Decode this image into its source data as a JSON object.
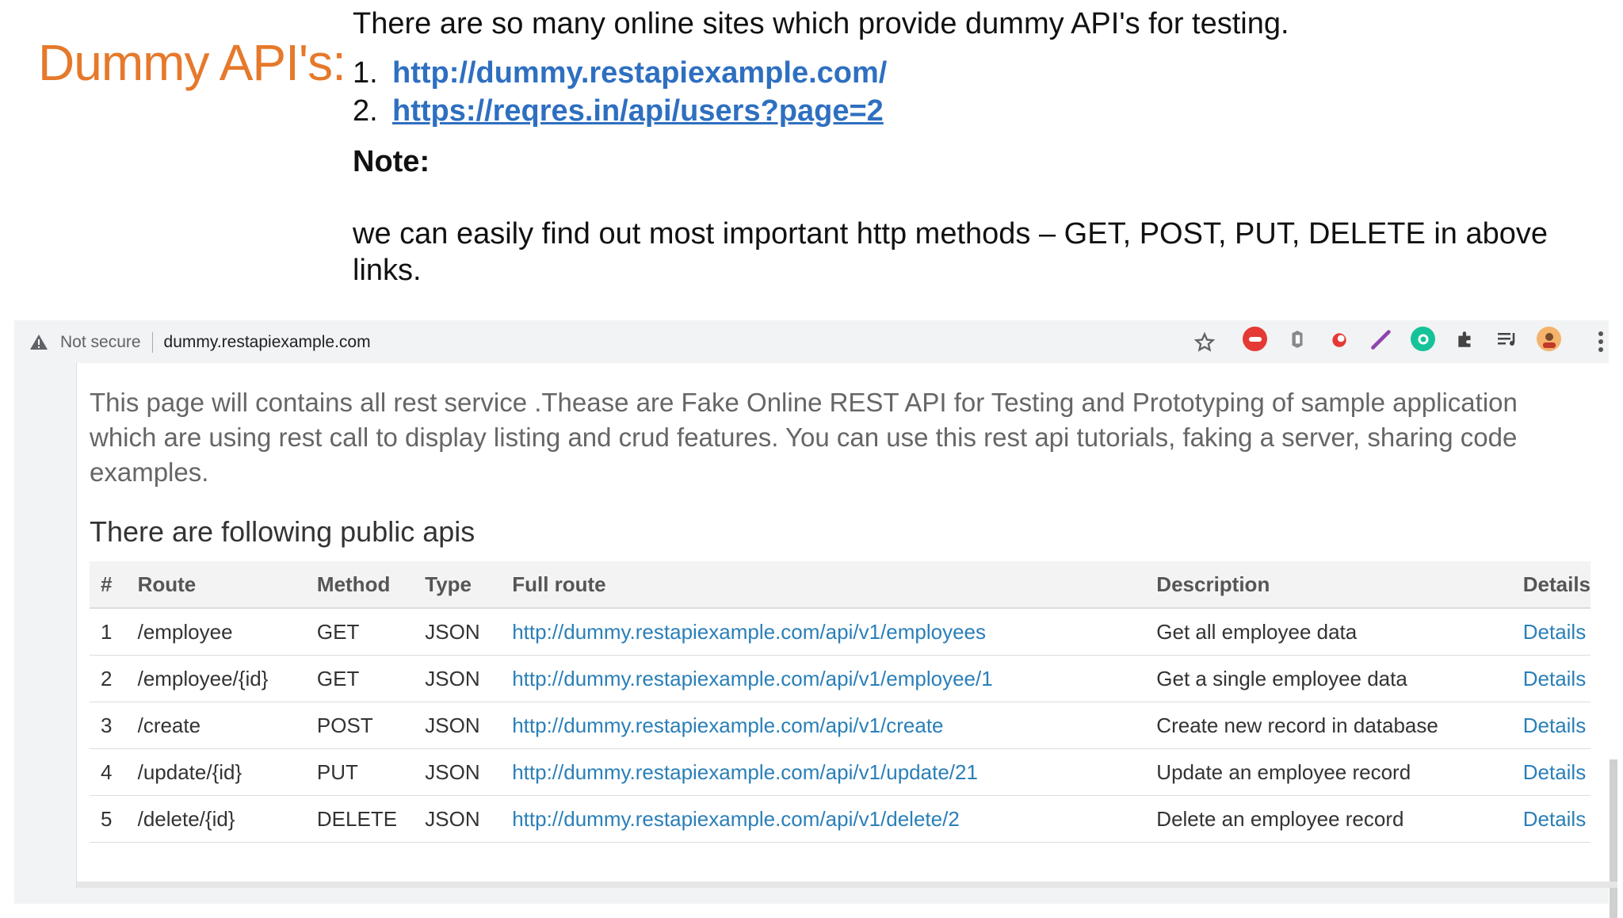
{
  "slide": {
    "title": "Dummy API's:",
    "intro": "There are so many online sites which provide dummy API's for testing.",
    "links": [
      {
        "num": "1.",
        "text": "http://dummy.restapiexample.com/"
      },
      {
        "num": "2.",
        "text": "https://reqres.in/api/users?page=2"
      }
    ],
    "note_heading": "Note:",
    "note_text": "we can easily find out most important http methods – GET, POST, PUT, DELETE in above links."
  },
  "browser": {
    "security_label": "Not secure",
    "host": "dummy.restapiexample.com",
    "extensions": [
      "red-extension-icon",
      "shield-extension-icon",
      "flame-extension-icon",
      "feather-extension-icon",
      "grammarly-icon",
      "puzzle-icon",
      "media-control-icon",
      "profile-avatar"
    ]
  },
  "page": {
    "description": "This page will contains all rest service .Thease are Fake Online REST API for Testing and Prototyping of sample application which are using rest call to display listing and crud features. You can use this rest api tutorials, faking a server, sharing code examples.",
    "section_heading": "There are following public apis",
    "table": {
      "headers": [
        "#",
        "Route",
        "Method",
        "Type",
        "Full route",
        "Description",
        "Details"
      ],
      "rows": [
        [
          "1",
          "/employee",
          "GET",
          "JSON",
          "http://dummy.restapiexample.com/api/v1/employees",
          "Get all employee data",
          "Details"
        ],
        [
          "2",
          "/employee/{id}",
          "GET",
          "JSON",
          "http://dummy.restapiexample.com/api/v1/employee/1",
          "Get a single employee data",
          "Details"
        ],
        [
          "3",
          "/create",
          "POST",
          "JSON",
          "http://dummy.restapiexample.com/api/v1/create",
          "Create new record in database",
          "Details"
        ],
        [
          "4",
          "/update/{id}",
          "PUT",
          "JSON",
          "http://dummy.restapiexample.com/api/v1/update/21",
          "Update an employee record",
          "Details"
        ],
        [
          "5",
          "/delete/{id}",
          "DELETE",
          "JSON",
          "http://dummy.restapiexample.com/api/v1/delete/2",
          "Delete an employee record",
          "Details"
        ]
      ]
    }
  },
  "colors": {
    "title": "#e6792b",
    "link": "#2e6fc0",
    "table_link": "#2a7fb8"
  }
}
